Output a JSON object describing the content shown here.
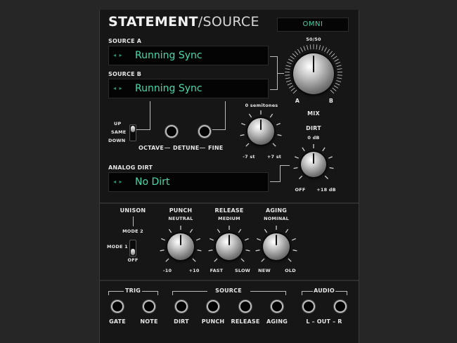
{
  "header": {
    "title_bold": "STATEMENT",
    "title_light": "/SOURCE",
    "mode_display": "OMNI"
  },
  "source_a": {
    "label": "SOURCE A",
    "arrows": "◂ ▸",
    "value": "Running Sync"
  },
  "source_b": {
    "label": "SOURCE B",
    "arrows": "◂ ▸",
    "value": "Running Sync"
  },
  "mix": {
    "top_label": "50/50",
    "left_label": "A",
    "right_label": "B",
    "label": "MIX"
  },
  "octave_switch": {
    "up": "UP",
    "same": "SAME",
    "down": "DOWN",
    "label": "OCTAVE"
  },
  "detune": {
    "label": "DETUNE",
    "fine_label": "FINE",
    "top_label": "0 semitones",
    "left_label": "-7 st",
    "right_label": "+7 st"
  },
  "dirt": {
    "label": "DIRT",
    "top_label": "0 dB",
    "left_label": "OFF",
    "right_label": "+18 dB"
  },
  "analog_dirt": {
    "label": "ANALOG DIRT",
    "arrows": "◂ ▸",
    "value": "No Dirt"
  },
  "unison": {
    "label": "UNISON",
    "mode2": "MODE 2",
    "mode1": "MODE 1",
    "off": "OFF"
  },
  "punch": {
    "label": "PUNCH",
    "top_label": "NEUTRAL",
    "left_label": "-10",
    "right_label": "+10"
  },
  "release": {
    "label": "RELEASE",
    "top_label": "MEDIUM",
    "left_label": "FAST",
    "right_label": "SLOW"
  },
  "aging": {
    "label": "AGING",
    "top_label": "NOMINAL",
    "left_label": "NEW",
    "right_label": "OLD"
  },
  "jacks": {
    "trig_group": "TRIG",
    "source_group": "SOURCE",
    "audio_group": "AUDIO",
    "gate": "GATE",
    "note": "NOTE",
    "dirt": "DIRT",
    "punch": "PUNCH",
    "release": "RELEASE",
    "aging": "AGING",
    "audio_out": "L – OUT – R"
  }
}
